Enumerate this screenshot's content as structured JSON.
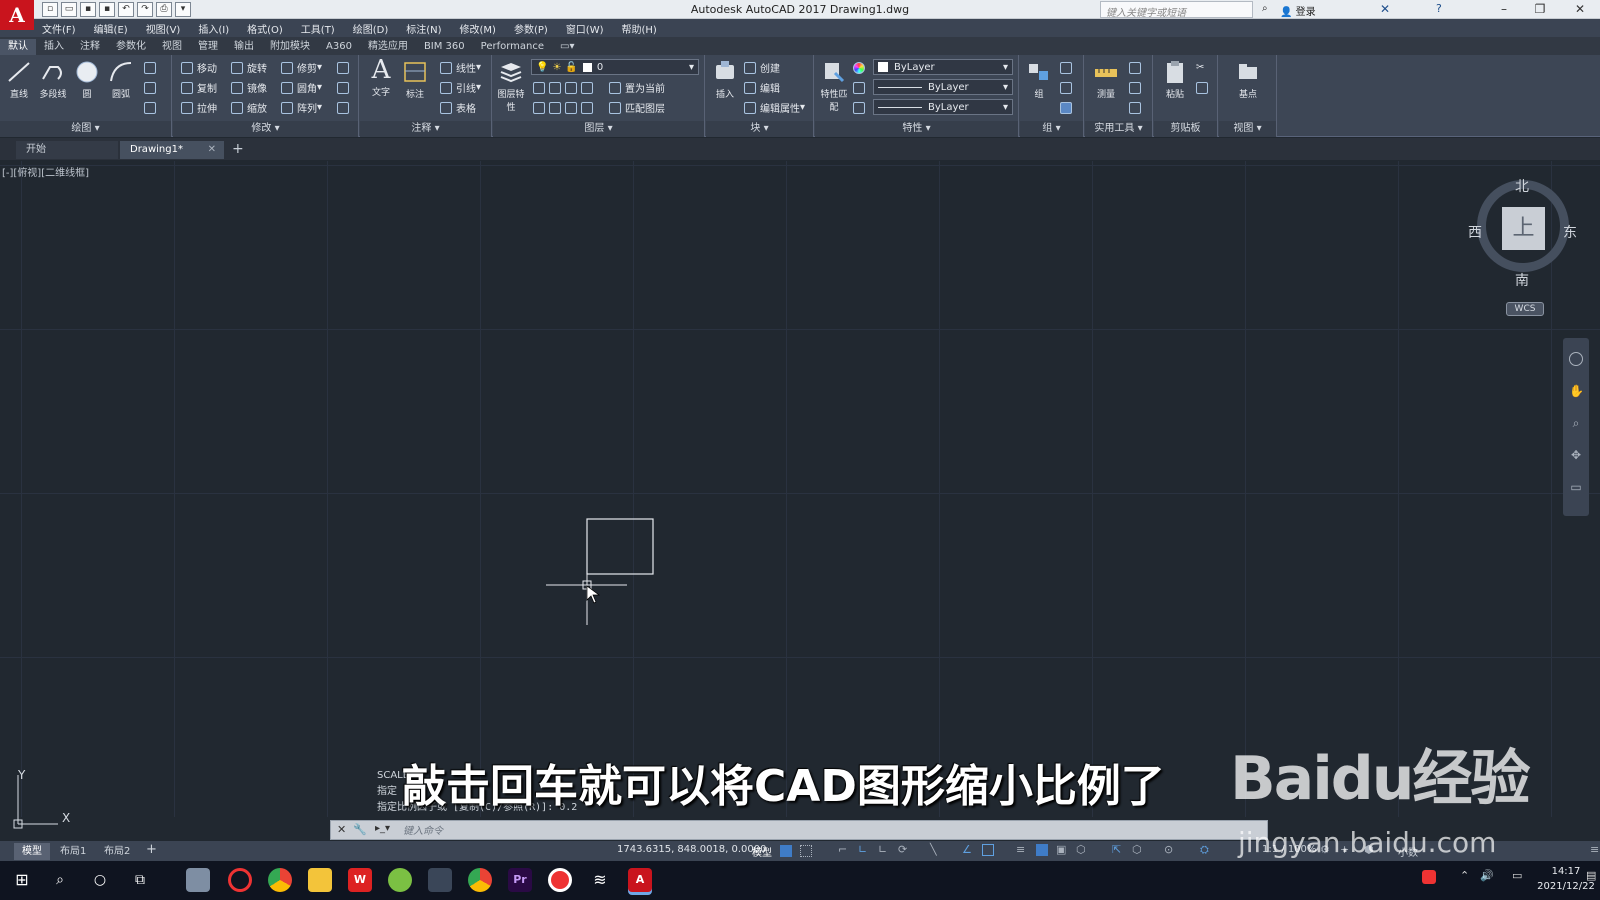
{
  "app": {
    "logo": "A",
    "title": "Autodesk AutoCAD 2017    Drawing1.dwg",
    "search_placeholder": "键入关键字或短语",
    "login": "登录",
    "help": "?"
  },
  "menu": [
    "文件(F)",
    "编辑(E)",
    "视图(V)",
    "插入(I)",
    "格式(O)",
    "工具(T)",
    "绘图(D)",
    "标注(N)",
    "修改(M)",
    "参数(P)",
    "窗口(W)",
    "帮助(H)"
  ],
  "ribbon_tabs": [
    "默认",
    "插入",
    "注释",
    "参数化",
    "视图",
    "管理",
    "输出",
    "附加模块",
    "A360",
    "精选应用",
    "BIM 360",
    "Performance"
  ],
  "ribbon": {
    "draw": {
      "title": "绘图",
      "line": "直线",
      "polyline": "多段线",
      "circle": "圆",
      "arc": "圆弧"
    },
    "modify": {
      "title": "修改",
      "move": "移动",
      "rotate": "旋转",
      "trim": "修剪",
      "copy": "复制",
      "mirror": "镜像",
      "fillet": "圆角",
      "stretch": "拉伸",
      "scale": "缩放",
      "array": "阵列"
    },
    "annotation": {
      "title": "注释",
      "text": "文字",
      "dimension": "标注",
      "linear": "线性",
      "leader": "引线",
      "table": "表格"
    },
    "layers": {
      "title": "图层",
      "props": "图层特性",
      "layer_value": "0",
      "make_current": "置为当前",
      "match_layer": "匹配图层"
    },
    "block": {
      "title": "块",
      "insert": "插入",
      "create": "创建",
      "edit": "编辑",
      "edit_attr": "编辑属性"
    },
    "properties": {
      "title": "特性",
      "match": "特性匹配",
      "color": "ByLayer",
      "linetype": "ByLayer",
      "lineweight": "ByLayer"
    },
    "groups": {
      "title": "组",
      "group": "组"
    },
    "utilities": {
      "title": "实用工具",
      "measure": "测量"
    },
    "clipboard": {
      "title": "剪贴板",
      "paste": "粘贴"
    },
    "view": {
      "title": "视图",
      "base": "基点"
    }
  },
  "file_tabs": [
    "开始",
    "Drawing1*"
  ],
  "viewport_label": "[-][俯视][二维线框]",
  "viewcube": {
    "north": "北",
    "south": "南",
    "east": "东",
    "west": "西",
    "top": "上",
    "wcs": "WCS"
  },
  "ucs": {
    "y": "Y",
    "x": "X"
  },
  "command": {
    "history": [
      "SCALE",
      "指定",
      "指定比例因子或 [复制(C)/参照(R)]: 0.2"
    ],
    "placeholder": "键入命令"
  },
  "layout_tabs": [
    "模型",
    "布局1",
    "布局2"
  ],
  "status": {
    "coords": "1743.6315, 848.0018, 0.0000",
    "model": "模型",
    "scale": "1:1 / 100%",
    "decimal": "小数"
  },
  "clock": {
    "time": "14:17",
    "date": "2021/12/22"
  },
  "subtitle": "敲击回车就可以将CAD图形缩小比例了",
  "watermark": {
    "brand": "Baidu经验",
    "url": "jingyan.baidu.com"
  }
}
